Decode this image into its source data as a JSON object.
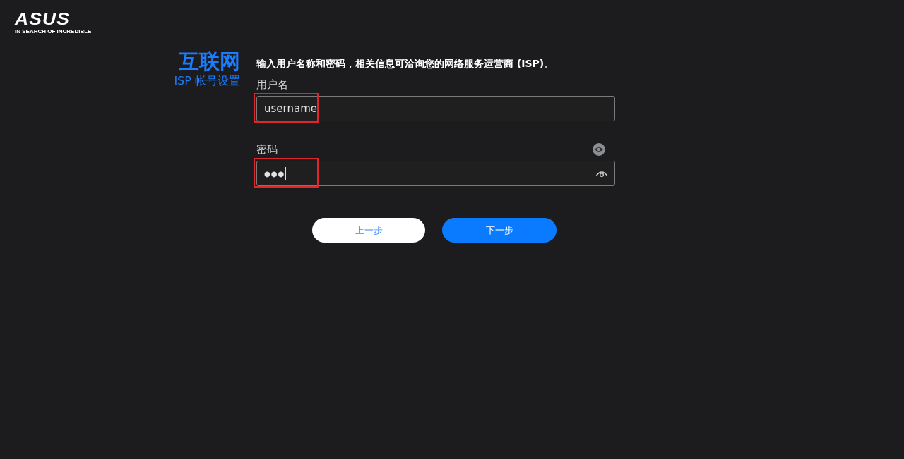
{
  "logo": {
    "wordmark": "ASUS",
    "tagline": "IN SEARCH OF INCREDIBLE"
  },
  "heading": {
    "title": "互联网",
    "subtitle": "ISP 帐号设置"
  },
  "instruction": "输入用户名称和密码，相关信息可洽询您的网络服务运营商 (ISP)。",
  "fields": [
    {
      "kind": "text",
      "label": "用户名",
      "value": "username",
      "highlighted": true
    },
    {
      "kind": "password",
      "label": "密码",
      "value": "●●●",
      "highlighted": true,
      "caret": true
    }
  ],
  "buttons": [
    {
      "label": "上一步",
      "primary": false
    },
    {
      "label": "下一步",
      "primary": true
    }
  ]
}
